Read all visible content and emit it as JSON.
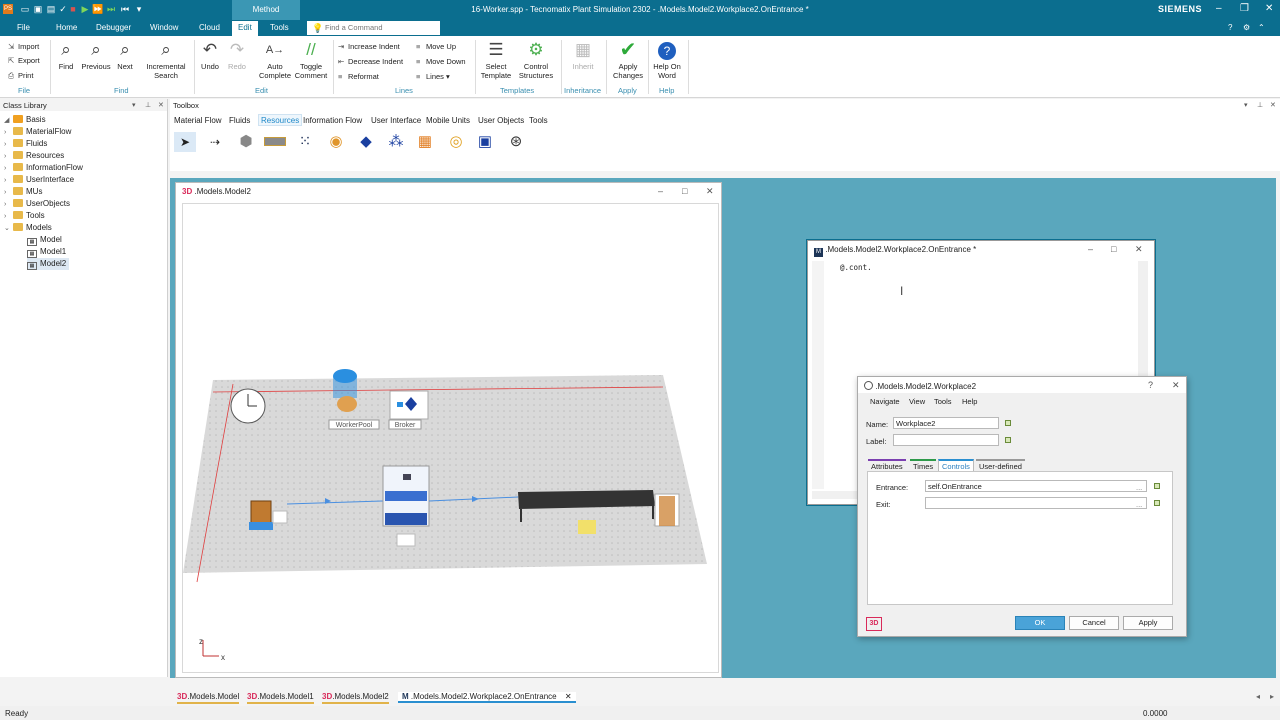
{
  "app": {
    "title": "16-Worker.spp - Tecnomatix Plant Simulation 2302 - .Models.Model2.Workplace2.OnEntrance *",
    "brand": "SIEMENS",
    "context_tab": "Method"
  },
  "menu": {
    "tabs": [
      "File",
      "Home",
      "Debugger",
      "Window",
      "Cloud",
      "Edit",
      "Tools"
    ],
    "active": "Edit",
    "command_placeholder": "Find a Command"
  },
  "ribbon": {
    "file": {
      "import": "Import",
      "export": "Export",
      "print": "Print",
      "group": "File"
    },
    "find": {
      "find": "Find",
      "previous": "Previous",
      "next": "Next",
      "incremental": "Incremental Search",
      "group": "Find"
    },
    "edit": {
      "undo": "Undo",
      "redo": "Redo",
      "autocomplete": "Auto Complete",
      "toggle_comment": "Toggle Comment",
      "group": "Edit"
    },
    "lines": {
      "increase": "Increase Indent",
      "decrease": "Decrease Indent",
      "reformat": "Reformat",
      "move_up": "Move Up",
      "move_down": "Move Down",
      "lines": "Lines",
      "group": "Lines"
    },
    "templates": {
      "select": "Select Template",
      "control": "Control Structures",
      "group": "Templates"
    },
    "inheritance": {
      "inherit": "Inherit",
      "group": "Inheritance"
    },
    "apply": {
      "apply": "Apply Changes",
      "group": "Apply"
    },
    "help": {
      "help": "Help On Word",
      "group": "Help"
    }
  },
  "class_library": {
    "title": "Class Library",
    "items": [
      {
        "label": "Basis",
        "level": 0
      },
      {
        "label": "MaterialFlow",
        "level": 1
      },
      {
        "label": "Fluids",
        "level": 1
      },
      {
        "label": "Resources",
        "level": 1
      },
      {
        "label": "InformationFlow",
        "level": 1
      },
      {
        "label": "UserInterface",
        "level": 1
      },
      {
        "label": "MUs",
        "level": 1
      },
      {
        "label": "UserObjects",
        "level": 1
      },
      {
        "label": "Tools",
        "level": 1
      },
      {
        "label": "Models",
        "level": 1
      },
      {
        "label": "Model",
        "level": 2
      },
      {
        "label": "Model1",
        "level": 2
      },
      {
        "label": "Model2",
        "level": 2
      }
    ],
    "selected": "Model2"
  },
  "toolbox": {
    "title": "Toolbox",
    "tabs": [
      "Material Flow",
      "Fluids",
      "Resources",
      "Information Flow",
      "User Interface",
      "Mobile Units",
      "User Objects",
      "Tools"
    ],
    "active": "Resources"
  },
  "window3d": {
    "badge": "3D",
    "title": ".Models.Model2",
    "labels": {
      "worker_pool": "WorkerPool",
      "broker": "Broker"
    },
    "axis_x": "x",
    "axis_z": "z"
  },
  "editor": {
    "title": ".Models.Model2.Workplace2.OnEntrance *",
    "code": "@.cont."
  },
  "dialog": {
    "title": ".Models.Model2.Workplace2",
    "menu": [
      "Navigate",
      "View",
      "Tools",
      "Help"
    ],
    "name_label": "Name:",
    "name_value": "Workplace2",
    "label_label": "Label:",
    "label_value": "",
    "tabs": [
      "Attributes",
      "Times",
      "Controls",
      "User-defined"
    ],
    "active_tab": "Controls",
    "entrance_label": "Entrance:",
    "entrance_value": "self.OnEntrance",
    "exit_label": "Exit:",
    "exit_value": "",
    "ok": "OK",
    "cancel": "Cancel",
    "apply": "Apply",
    "badge": "3D",
    "help": "?"
  },
  "doc_tabs": [
    "3D .Models.Model",
    "3D .Models.Model1",
    "3D .Models.Model2",
    ".Models.Model2.Workplace2.OnEntrance"
  ],
  "doc_tab_parts": [
    {
      "prefix": "3D",
      "name": ".Models.Model"
    },
    {
      "prefix": "3D",
      "name": ".Models.Model1"
    },
    {
      "prefix": "3D",
      "name": ".Models.Model2"
    },
    {
      "prefix": "M",
      "name": ".Models.Model2.Workplace2.OnEntrance"
    }
  ],
  "status": {
    "left": "Ready",
    "right": "0.0000"
  },
  "colors": {
    "accent": "#0b6e8f",
    "mdi_bg": "#5aa7bd",
    "selection": "#1e88c8"
  }
}
